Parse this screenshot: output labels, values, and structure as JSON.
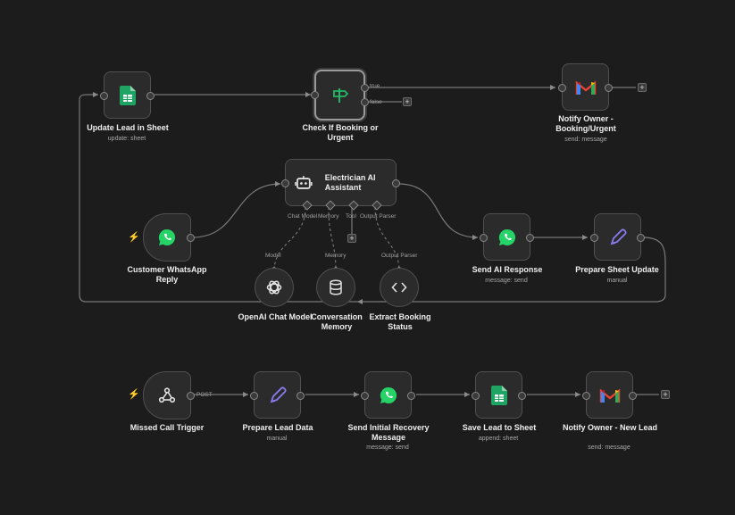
{
  "colors": {
    "background": "#1c1c1c",
    "node_bg": "#2b2b2b",
    "sheets_green": "#1fa463",
    "whatsapp_green": "#25d366",
    "trigger_bolt": "#ff5a3c",
    "edit_purple": "#8b7cf0"
  },
  "nodes": {
    "update_lead": {
      "title": "Update Lead in Sheet",
      "subtitle": "update: sheet",
      "icon": "google-sheets-icon"
    },
    "check_booking": {
      "title": "Check If Booking or Urgent",
      "icon": "signpost-icon",
      "true_label": "true",
      "false_label": "false"
    },
    "notify_booking": {
      "title": "Notify Owner - Booking/Urgent",
      "subtitle": "send: message",
      "icon": "gmail-icon"
    },
    "ai_agent": {
      "title": "Electrician AI Assistant",
      "icon": "robot-icon",
      "ports": [
        "Chat Model",
        "Memory",
        "Tool",
        "Output Parser"
      ]
    },
    "whatsapp_reply": {
      "title": "Customer WhatsApp Reply",
      "icon": "whatsapp-icon"
    },
    "send_ai": {
      "title": "Send AI Response",
      "subtitle": "message: send",
      "icon": "whatsapp-icon"
    },
    "prepare_sheet": {
      "title": "Prepare Sheet Update",
      "subtitle": "manual",
      "icon": "pencil-icon"
    },
    "openai": {
      "title": "OpenAI Chat Model",
      "icon": "openai-icon",
      "link_label": "Model"
    },
    "memory": {
      "title": "Conversation Memory",
      "icon": "database-icon",
      "link_label": "Memory"
    },
    "parser": {
      "title": "Extract Booking Status",
      "icon": "code-icon",
      "link_label": "Output Parser"
    },
    "missed_call": {
      "title": "Missed Call Trigger",
      "icon": "webhook-icon",
      "method": "POST"
    },
    "prepare_lead": {
      "title": "Prepare Lead Data",
      "subtitle": "manual",
      "icon": "pencil-icon"
    },
    "send_initial": {
      "title": "Send Initial Recovery Message",
      "subtitle": "message: send",
      "icon": "whatsapp-icon"
    },
    "save_lead": {
      "title": "Save Lead to Sheet",
      "subtitle": "append: sheet",
      "icon": "google-sheets-icon"
    },
    "notify_new": {
      "title": "Notify Owner - New Lead",
      "subtitle": "send: message",
      "icon": "gmail-icon"
    }
  },
  "plus_symbol": "+"
}
